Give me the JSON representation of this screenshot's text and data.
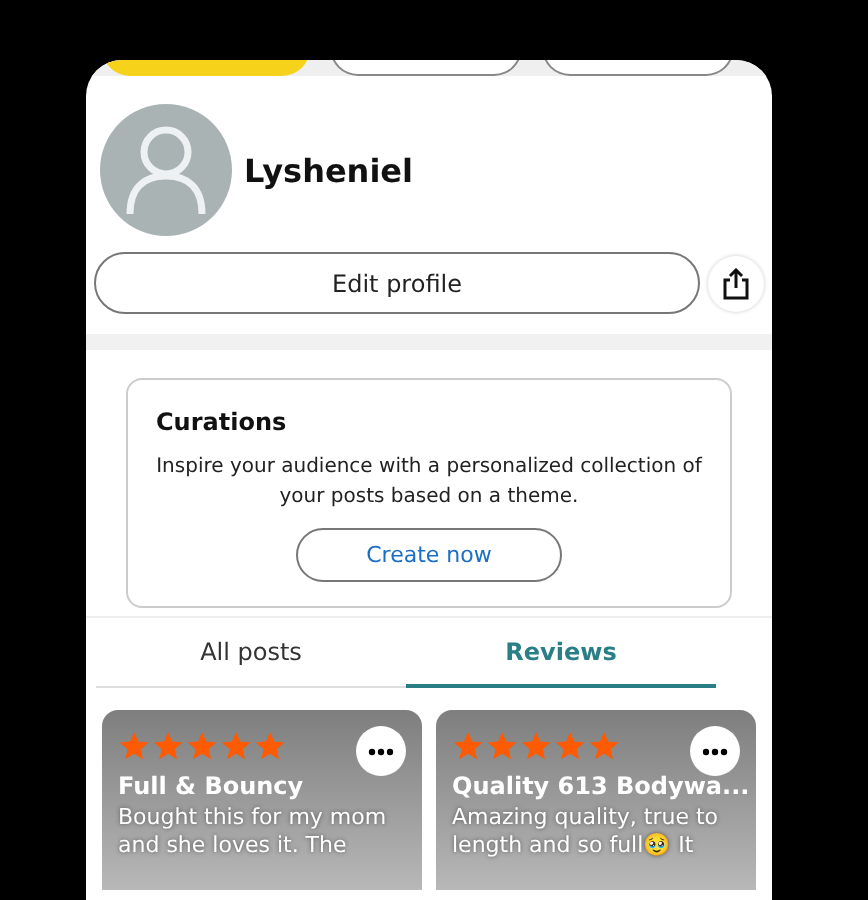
{
  "chips": [
    {
      "selected": true
    },
    {
      "selected": false
    },
    {
      "selected": false
    }
  ],
  "profile": {
    "name": "Lysheniel",
    "edit_button": "Edit profile"
  },
  "curations": {
    "title": "Curations",
    "description": "Inspire your audience with a personalized collection of your posts based on a theme.",
    "button": "Create now"
  },
  "tabs": [
    {
      "label": "All posts",
      "selected": false
    },
    {
      "label": "Reviews",
      "selected": true
    }
  ],
  "reviews": [
    {
      "stars": 5,
      "title": "Full & Bouncy",
      "body": "Bought this for my mom and she loves it. The"
    },
    {
      "stars": 5,
      "title": "Quality 613 Bodywa...",
      "body": "Amazing quality, true to length and so full🥹 It"
    }
  ]
}
